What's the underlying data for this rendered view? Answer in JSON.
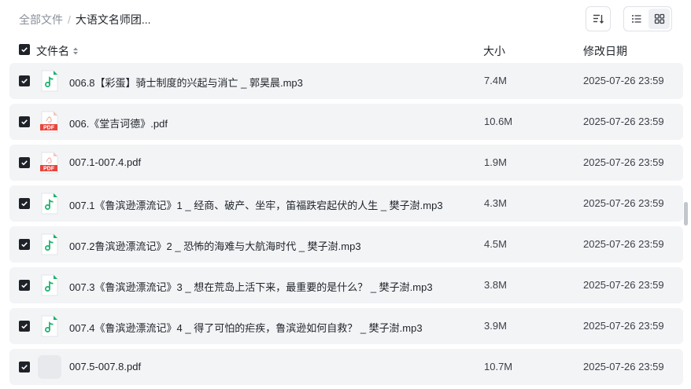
{
  "breadcrumb": {
    "root": "全部文件",
    "separator": "/",
    "current": "大语文名师团..."
  },
  "columns": {
    "name": "文件名",
    "size": "大小",
    "modified": "修改日期"
  },
  "files": [
    {
      "name": "006.8【彩蛋】骑士制度的兴起与消亡 _ 郭昊晨.mp3",
      "size": "7.4M",
      "modified": "2025-07-26 23:59",
      "type": "audio"
    },
    {
      "name": "006.《堂吉诃德》.pdf",
      "size": "10.6M",
      "modified": "2025-07-26 23:59",
      "type": "pdf"
    },
    {
      "name": "007.1-007.4.pdf",
      "size": "1.9M",
      "modified": "2025-07-26 23:59",
      "type": "pdf"
    },
    {
      "name": "007.1《鲁滨逊漂流记》1 _ 经商、破产、坐牢，笛福跌宕起伏的人生 _ 樊子澍.mp3",
      "size": "4.3M",
      "modified": "2025-07-26 23:59",
      "type": "audio"
    },
    {
      "name": "007.2鲁滨逊漂流记》2 _ 恐怖的海难与大航海时代 _ 樊子澍.mp3",
      "size": "4.5M",
      "modified": "2025-07-26 23:59",
      "type": "audio"
    },
    {
      "name": "007.3《鲁滨逊漂流记》3 _ 想在荒岛上活下来，最重要的是什么？ _ 樊子澍.mp3",
      "size": "3.8M",
      "modified": "2025-07-26 23:59",
      "type": "audio"
    },
    {
      "name": "007.4《鲁滨逊漂流记》4 _ 得了可怕的疟疾，鲁滨逊如何自救？ _ 樊子澍.mp3",
      "size": "3.9M",
      "modified": "2025-07-26 23:59",
      "type": "audio"
    },
    {
      "name": "007.5-007.8.pdf",
      "size": "10.7M",
      "modified": "2025-07-26 23:59",
      "type": "blank"
    }
  ],
  "icons": {
    "pdf_label": "PDF",
    "audio_color": "#19b26b",
    "pdf_color": "#e8453c"
  }
}
